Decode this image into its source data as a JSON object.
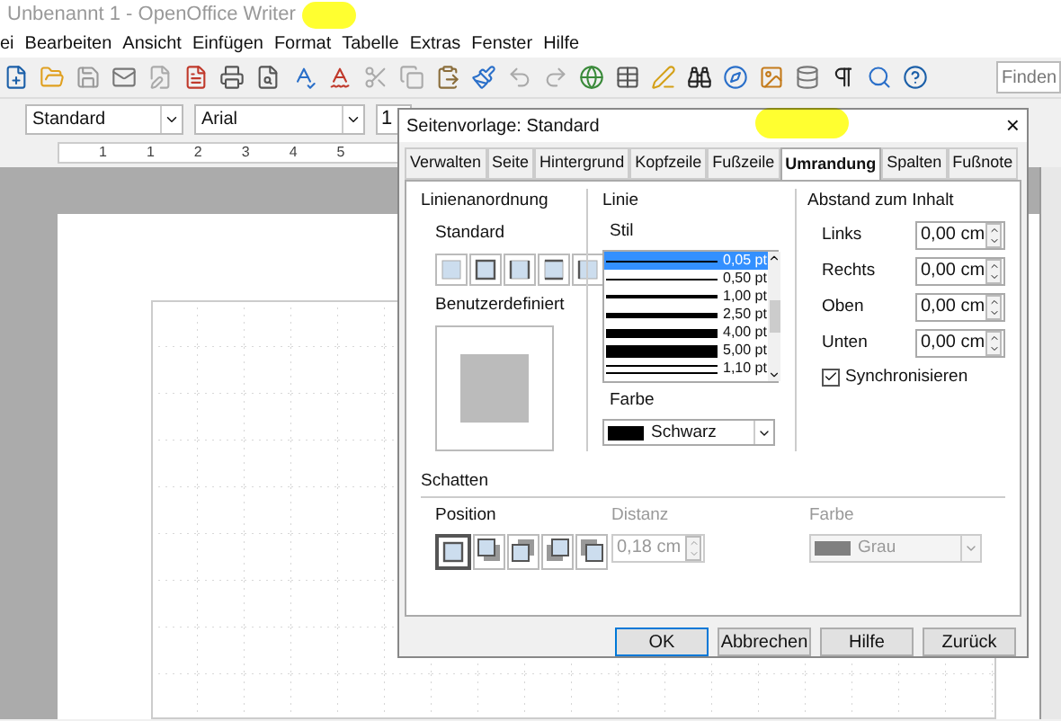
{
  "window": {
    "title": "Unbenannt 1 - OpenOffice Writer"
  },
  "menu": [
    {
      "label": "ei"
    },
    {
      "label": "Bearbeiten"
    },
    {
      "label": "Ansicht"
    },
    {
      "label": "Einfügen"
    },
    {
      "label": "Format"
    },
    {
      "label": "Tabelle"
    },
    {
      "label": "Extras"
    },
    {
      "label": "Fenster"
    },
    {
      "label": "Hilfe"
    }
  ],
  "toolbar": {
    "find_placeholder": "Finden"
  },
  "format_bar": {
    "style": "Standard",
    "font": "Arial",
    "size": "1"
  },
  "ruler": {
    "labels": [
      "1",
      "1",
      "2",
      "3",
      "4",
      "5"
    ]
  },
  "dialog": {
    "title": "Seitenvorlage: Standard",
    "close": "×",
    "tabs": [
      {
        "label": "Verwalten",
        "selected": false
      },
      {
        "label": "Seite",
        "selected": false
      },
      {
        "label": "Hintergrund",
        "selected": false
      },
      {
        "label": "Kopfzeile",
        "selected": false
      },
      {
        "label": "Fußzeile",
        "selected": false
      },
      {
        "label": "Umrandung",
        "selected": true
      },
      {
        "label": "Spalten",
        "selected": false
      },
      {
        "label": "Fußnote",
        "selected": false
      }
    ],
    "line_arrangement": {
      "heading": "Linienanordnung",
      "standard_label": "Standard",
      "presets": [
        {
          "kind": "none",
          "selected": false
        },
        {
          "kind": "box",
          "selected": false
        },
        {
          "kind": "sides",
          "selected": false
        },
        {
          "kind": "topbottom",
          "selected": false
        },
        {
          "kind": "left",
          "selected": false
        }
      ],
      "custom_label": "Benutzerdefiniert"
    },
    "line": {
      "heading": "Linie",
      "style_label": "Stil",
      "styles": [
        {
          "label": "0,05 pt",
          "kind": "hair",
          "selected": true
        },
        {
          "label": "0,50 pt",
          "kind": "thin",
          "selected": false
        },
        {
          "label": "1,00 pt",
          "kind": "medium",
          "selected": false
        },
        {
          "label": "2,50 pt",
          "kind": "thick",
          "selected": false
        },
        {
          "label": "4,00 pt",
          "kind": "heavy",
          "selected": false
        },
        {
          "label": "5,00 pt",
          "kind": "heaviest",
          "selected": false
        },
        {
          "label": "1,10 pt",
          "kind": "double",
          "selected": false
        }
      ],
      "color_label": "Farbe",
      "color": {
        "name": "Schwarz",
        "color": "#000000"
      }
    },
    "spacing": {
      "heading": "Abstand zum Inhalt",
      "fields": [
        {
          "label": "Links",
          "value": "0,00 cm"
        },
        {
          "label": "Rechts",
          "value": "0,00 cm"
        },
        {
          "label": "Oben",
          "value": "0,00 cm"
        },
        {
          "label": "Unten",
          "value": "0,00 cm"
        }
      ],
      "sync": {
        "label": "Synchronisieren",
        "checked": true
      }
    },
    "shadow": {
      "heading": "Schatten",
      "position_label": "Position",
      "positions": [
        {
          "kind": "none",
          "selected": true
        },
        {
          "kind": "br",
          "selected": false
        },
        {
          "kind": "tr",
          "selected": false
        },
        {
          "kind": "bl",
          "selected": false
        },
        {
          "kind": "tl",
          "selected": false
        }
      ],
      "distance_label": "Distanz",
      "distance": {
        "value": "0,18 cm",
        "disabled": true
      },
      "color_label": "Farbe",
      "color": {
        "name": "Grau",
        "color": "#808080",
        "disabled": true
      }
    },
    "buttons": [
      {
        "label": "OK",
        "default": true
      },
      {
        "label": "Abbrechen",
        "default": false
      },
      {
        "label": "Hilfe",
        "default": false
      },
      {
        "label": "Zurück",
        "default": false
      }
    ]
  }
}
